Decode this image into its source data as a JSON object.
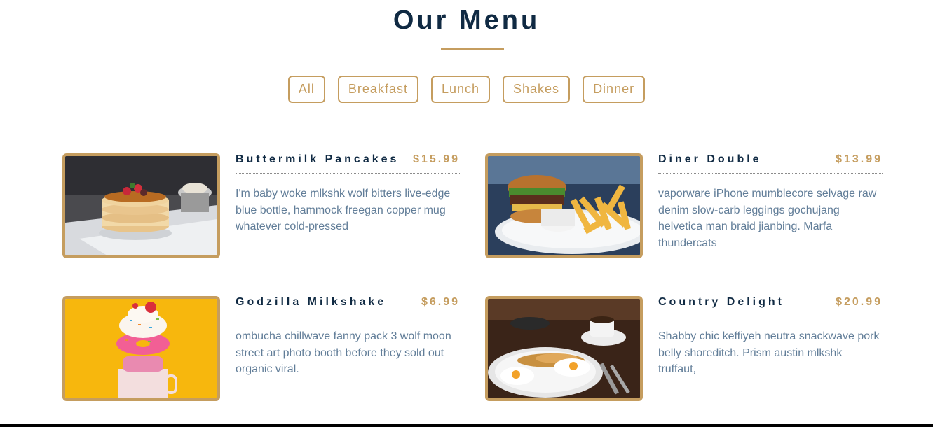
{
  "page": {
    "title": "Our Menu"
  },
  "filters": [
    "All",
    "Breakfast",
    "Lunch",
    "Shakes",
    "Dinner"
  ],
  "items": [
    {
      "name": "Buttermilk Pancakes",
      "price": "$15.99",
      "desc": "I'm baby woke mlkshk wolf bitters live-edge blue bottle, hammock freegan copper mug whatever cold-pressed",
      "image": "pancakes-photo"
    },
    {
      "name": "Diner Double",
      "price": "$13.99",
      "desc": "vaporware iPhone mumblecore selvage raw denim slow-carb leggings gochujang helvetica man braid jianbing. Marfa thundercats",
      "image": "burger-fries-photo"
    },
    {
      "name": "Godzilla Milkshake",
      "price": "$6.99",
      "desc": "ombucha chillwave fanny pack 3 wolf moon street art photo booth before they sold out organic viral.",
      "image": "milkshake-photo"
    },
    {
      "name": "Country Delight",
      "price": "$20.99",
      "desc": "Shabby chic keffiyeh neutra snackwave pork belly shoreditch. Prism austin mlkshk truffaut,",
      "image": "eggs-breakfast-photo"
    }
  ],
  "colors": {
    "accent": "#c59d5f",
    "heading": "#102a43",
    "text": "#617d98"
  }
}
